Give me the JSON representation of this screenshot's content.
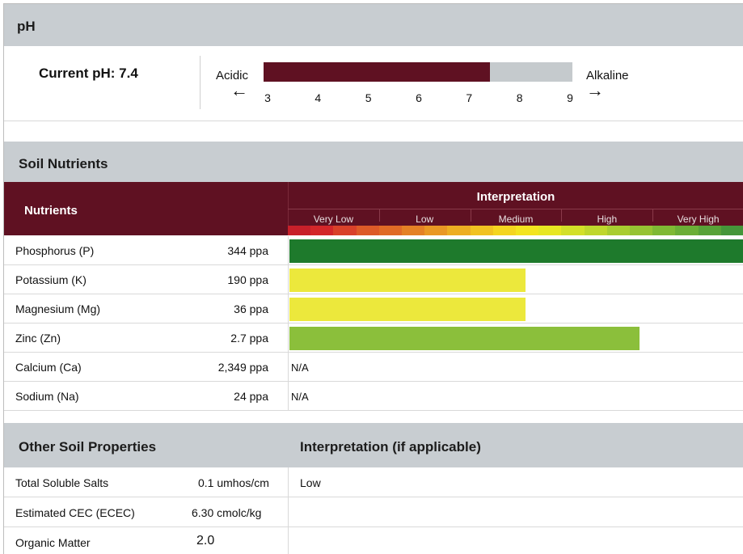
{
  "ph": {
    "section_title": "pH",
    "current_label": "Current pH: 7.4",
    "current_value": 7.4,
    "scale_min": 3,
    "scale_max": 9,
    "acidic_label": "Acidic",
    "alkaline_label": "Alkaline",
    "left_arrow": "🡐",
    "right_arrow": "🡒",
    "ticks": [
      "3",
      "4",
      "5",
      "6",
      "7",
      "8",
      "9"
    ],
    "colors": {
      "fill": "#5f1122",
      "track": "#c5cacd"
    }
  },
  "nutrients": {
    "section_title": "Soil Nutrients",
    "column_label": "Nutrients",
    "interpretation_label": "Interpretation",
    "scale_labels": [
      "Very Low",
      "Low",
      "Medium",
      "High",
      "Very High"
    ],
    "gradient_colors": [
      "#c8202a",
      "#d3272a",
      "#d9412a",
      "#dd5a28",
      "#e06b26",
      "#e48125",
      "#e99824",
      "#edae22",
      "#f1c221",
      "#f4d51f",
      "#f3e41f",
      "#e7e722",
      "#d3e028",
      "#bfd72c",
      "#a9cd30",
      "#96c333",
      "#7fb934",
      "#6bae36",
      "#58a238",
      "#45963a"
    ],
    "rows": [
      {
        "name": "Phosphorus (P)",
        "value": "344 ppa",
        "level": 1.0,
        "color": "#1e7a2c",
        "na": ""
      },
      {
        "name": "Potassium (K)",
        "value": "190 ppa",
        "level": 0.52,
        "color": "#ece83c",
        "na": ""
      },
      {
        "name": "Magnesium (Mg)",
        "value": "36 ppa",
        "level": 0.52,
        "color": "#ece83c",
        "na": ""
      },
      {
        "name": "Zinc (Zn)",
        "value": "2.7 ppa",
        "level": 0.77,
        "color": "#8bbf3b",
        "na": ""
      },
      {
        "name": "Calcium (Ca)",
        "value": "2,349 ppa",
        "level": 0,
        "color": "",
        "na": "N/A"
      },
      {
        "name": "Sodium (Na)",
        "value": "24 ppa",
        "level": 0,
        "color": "",
        "na": "N/A"
      }
    ]
  },
  "other": {
    "section_title": "Other Soil Properties",
    "interpretation_title": "Interpretation (if applicable)",
    "rows": [
      {
        "name": "Total Soluble Salts",
        "value": "0.1 umhos/cm",
        "interpretation": "Low"
      },
      {
        "name": "Estimated CEC (ECEC)",
        "value": "6.30 cmolc/kg",
        "interpretation": ""
      },
      {
        "name": "Organic Matter",
        "value": "2.0",
        "interpretation": ""
      }
    ]
  },
  "colors": {
    "header_gray": "#c8cdd1",
    "maroon": "#5f1122"
  }
}
